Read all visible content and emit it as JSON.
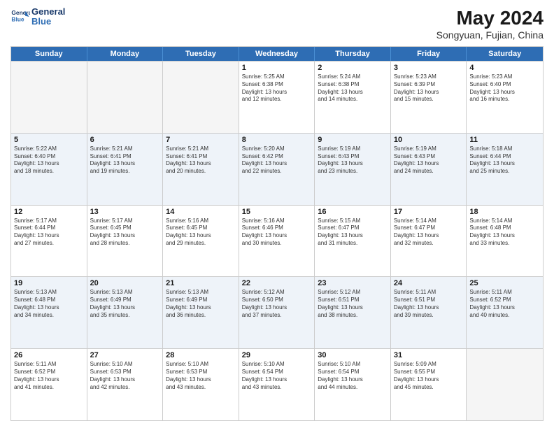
{
  "header": {
    "logo_line1": "General",
    "logo_line2": "Blue",
    "title": "May 2024",
    "subtitle": "Songyuan, Fujian, China"
  },
  "calendar": {
    "days_of_week": [
      "Sunday",
      "Monday",
      "Tuesday",
      "Wednesday",
      "Thursday",
      "Friday",
      "Saturday"
    ],
    "rows": [
      [
        {
          "day": "",
          "info": ""
        },
        {
          "day": "",
          "info": ""
        },
        {
          "day": "",
          "info": ""
        },
        {
          "day": "1",
          "info": "Sunrise: 5:25 AM\nSunset: 6:38 PM\nDaylight: 13 hours\nand 12 minutes."
        },
        {
          "day": "2",
          "info": "Sunrise: 5:24 AM\nSunset: 6:38 PM\nDaylight: 13 hours\nand 14 minutes."
        },
        {
          "day": "3",
          "info": "Sunrise: 5:23 AM\nSunset: 6:39 PM\nDaylight: 13 hours\nand 15 minutes."
        },
        {
          "day": "4",
          "info": "Sunrise: 5:23 AM\nSunset: 6:40 PM\nDaylight: 13 hours\nand 16 minutes."
        }
      ],
      [
        {
          "day": "5",
          "info": "Sunrise: 5:22 AM\nSunset: 6:40 PM\nDaylight: 13 hours\nand 18 minutes."
        },
        {
          "day": "6",
          "info": "Sunrise: 5:21 AM\nSunset: 6:41 PM\nDaylight: 13 hours\nand 19 minutes."
        },
        {
          "day": "7",
          "info": "Sunrise: 5:21 AM\nSunset: 6:41 PM\nDaylight: 13 hours\nand 20 minutes."
        },
        {
          "day": "8",
          "info": "Sunrise: 5:20 AM\nSunset: 6:42 PM\nDaylight: 13 hours\nand 22 minutes."
        },
        {
          "day": "9",
          "info": "Sunrise: 5:19 AM\nSunset: 6:43 PM\nDaylight: 13 hours\nand 23 minutes."
        },
        {
          "day": "10",
          "info": "Sunrise: 5:19 AM\nSunset: 6:43 PM\nDaylight: 13 hours\nand 24 minutes."
        },
        {
          "day": "11",
          "info": "Sunrise: 5:18 AM\nSunset: 6:44 PM\nDaylight: 13 hours\nand 25 minutes."
        }
      ],
      [
        {
          "day": "12",
          "info": "Sunrise: 5:17 AM\nSunset: 6:44 PM\nDaylight: 13 hours\nand 27 minutes."
        },
        {
          "day": "13",
          "info": "Sunrise: 5:17 AM\nSunset: 6:45 PM\nDaylight: 13 hours\nand 28 minutes."
        },
        {
          "day": "14",
          "info": "Sunrise: 5:16 AM\nSunset: 6:45 PM\nDaylight: 13 hours\nand 29 minutes."
        },
        {
          "day": "15",
          "info": "Sunrise: 5:16 AM\nSunset: 6:46 PM\nDaylight: 13 hours\nand 30 minutes."
        },
        {
          "day": "16",
          "info": "Sunrise: 5:15 AM\nSunset: 6:47 PM\nDaylight: 13 hours\nand 31 minutes."
        },
        {
          "day": "17",
          "info": "Sunrise: 5:14 AM\nSunset: 6:47 PM\nDaylight: 13 hours\nand 32 minutes."
        },
        {
          "day": "18",
          "info": "Sunrise: 5:14 AM\nSunset: 6:48 PM\nDaylight: 13 hours\nand 33 minutes."
        }
      ],
      [
        {
          "day": "19",
          "info": "Sunrise: 5:13 AM\nSunset: 6:48 PM\nDaylight: 13 hours\nand 34 minutes."
        },
        {
          "day": "20",
          "info": "Sunrise: 5:13 AM\nSunset: 6:49 PM\nDaylight: 13 hours\nand 35 minutes."
        },
        {
          "day": "21",
          "info": "Sunrise: 5:13 AM\nSunset: 6:49 PM\nDaylight: 13 hours\nand 36 minutes."
        },
        {
          "day": "22",
          "info": "Sunrise: 5:12 AM\nSunset: 6:50 PM\nDaylight: 13 hours\nand 37 minutes."
        },
        {
          "day": "23",
          "info": "Sunrise: 5:12 AM\nSunset: 6:51 PM\nDaylight: 13 hours\nand 38 minutes."
        },
        {
          "day": "24",
          "info": "Sunrise: 5:11 AM\nSunset: 6:51 PM\nDaylight: 13 hours\nand 39 minutes."
        },
        {
          "day": "25",
          "info": "Sunrise: 5:11 AM\nSunset: 6:52 PM\nDaylight: 13 hours\nand 40 minutes."
        }
      ],
      [
        {
          "day": "26",
          "info": "Sunrise: 5:11 AM\nSunset: 6:52 PM\nDaylight: 13 hours\nand 41 minutes."
        },
        {
          "day": "27",
          "info": "Sunrise: 5:10 AM\nSunset: 6:53 PM\nDaylight: 13 hours\nand 42 minutes."
        },
        {
          "day": "28",
          "info": "Sunrise: 5:10 AM\nSunset: 6:53 PM\nDaylight: 13 hours\nand 43 minutes."
        },
        {
          "day": "29",
          "info": "Sunrise: 5:10 AM\nSunset: 6:54 PM\nDaylight: 13 hours\nand 43 minutes."
        },
        {
          "day": "30",
          "info": "Sunrise: 5:10 AM\nSunset: 6:54 PM\nDaylight: 13 hours\nand 44 minutes."
        },
        {
          "day": "31",
          "info": "Sunrise: 5:09 AM\nSunset: 6:55 PM\nDaylight: 13 hours\nand 45 minutes."
        },
        {
          "day": "",
          "info": ""
        }
      ]
    ]
  }
}
